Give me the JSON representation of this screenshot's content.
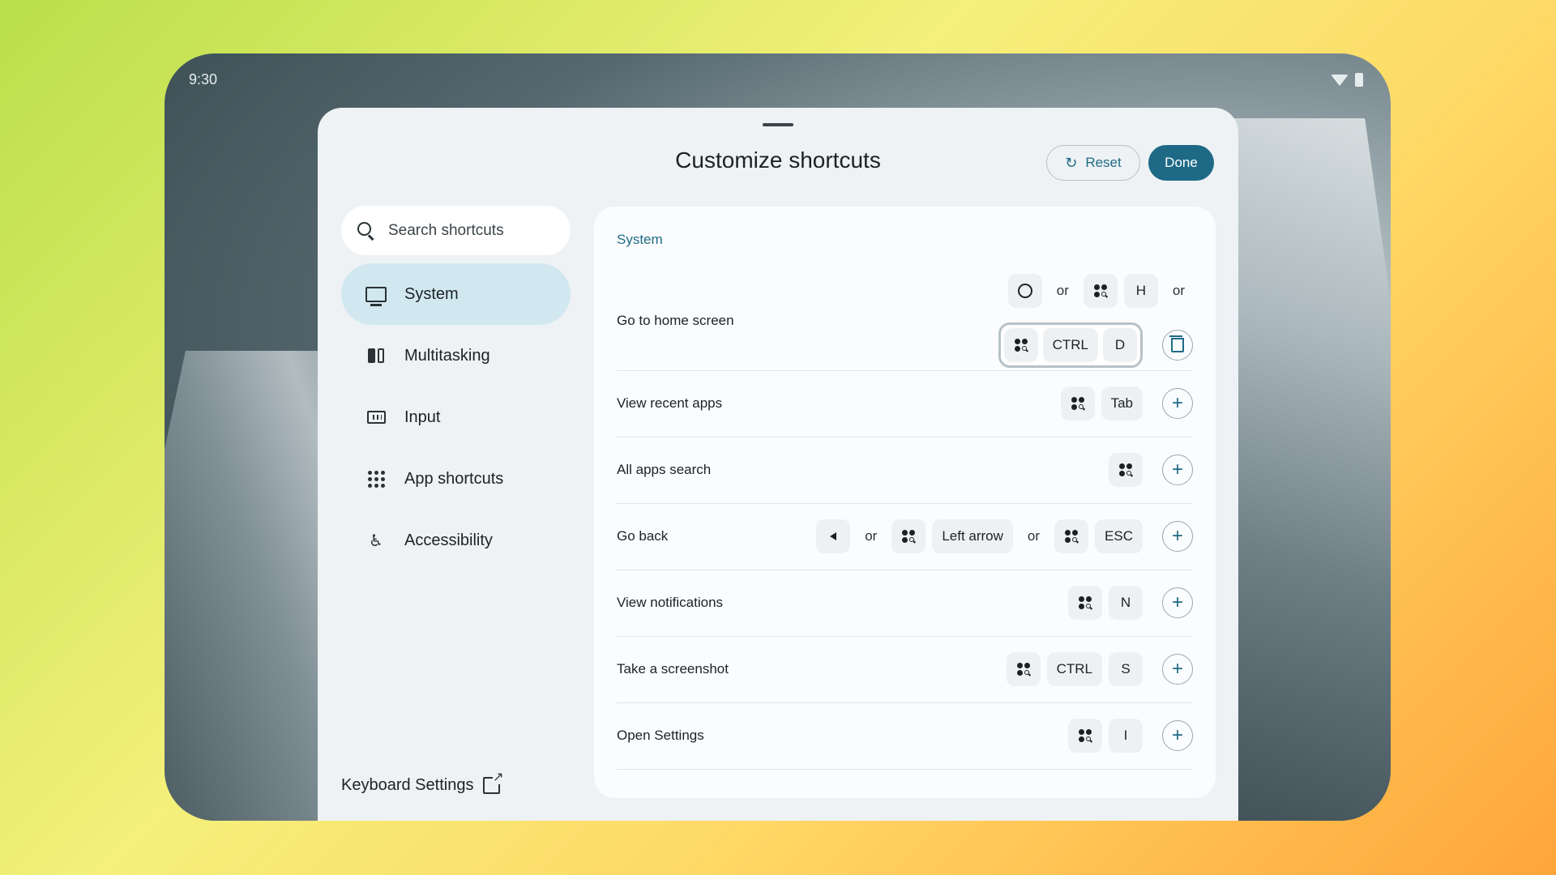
{
  "status_bar": {
    "time": "9:30"
  },
  "sheet": {
    "title": "Customize shortcuts",
    "reset_label": "Reset",
    "done_label": "Done"
  },
  "search": {
    "placeholder": "Search shortcuts"
  },
  "sidebar": {
    "items": [
      {
        "label": "System",
        "icon": "monitor-icon",
        "active": true
      },
      {
        "label": "Multitasking",
        "icon": "split-screen-icon"
      },
      {
        "label": "Input",
        "icon": "keyboard-icon"
      },
      {
        "label": "App shortcuts",
        "icon": "apps-grid-icon"
      },
      {
        "label": "Accessibility",
        "icon": "accessibility-icon"
      }
    ],
    "keyboard_settings_label": "Keyboard Settings"
  },
  "shortcuts": {
    "section_title": "System",
    "or": "or",
    "rows": [
      {
        "label": "Go to home screen",
        "keys_line1": [
          "home-circle-icon",
          "or",
          "meta-icon",
          "H",
          "or"
        ],
        "keys_line2": [
          "meta-icon",
          "CTRL",
          "D"
        ]
      },
      {
        "label": "View recent apps",
        "keys": [
          "meta-icon",
          "Tab"
        ]
      },
      {
        "label": "All apps search",
        "keys": [
          "meta-icon"
        ]
      },
      {
        "label": "Go back",
        "keys": [
          "back-icon",
          "or",
          "meta-icon",
          "Left arrow",
          "or",
          "meta-icon",
          "ESC"
        ]
      },
      {
        "label": "View notifications",
        "keys": [
          "meta-icon",
          "N"
        ]
      },
      {
        "label": "Take a screenshot",
        "keys": [
          "meta-icon",
          "CTRL",
          "S"
        ]
      },
      {
        "label": "Open Settings",
        "keys": [
          "meta-icon",
          "I"
        ]
      }
    ]
  },
  "colors": {
    "accent": "#1e6a86",
    "active_nav": "#d2e8f0",
    "sheet_bg": "#eef2f5"
  }
}
